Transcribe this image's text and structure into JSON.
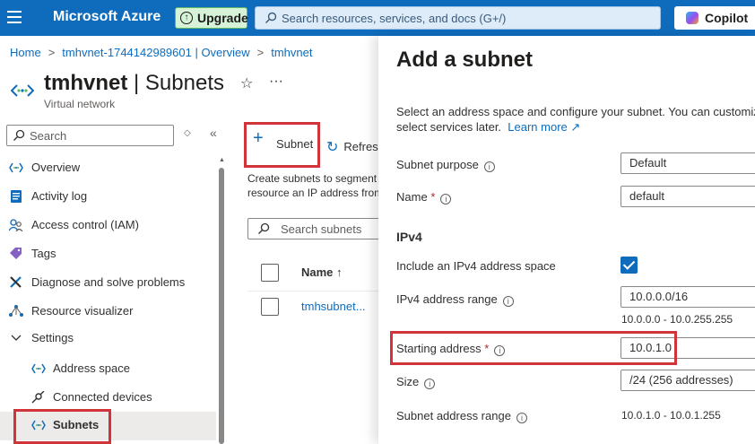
{
  "topbar": {
    "brand": "Microsoft Azure",
    "upgrade_label": "Upgrade",
    "search_placeholder": "Search resources, services, and docs (G+/)",
    "copilot_label": "Copilot"
  },
  "breadcrumb": [
    "Home",
    "tmhvnet-1744142989601 | Overview",
    "tmhvnet"
  ],
  "header": {
    "resource_name": "tmhvnet",
    "page_name": "Subnets",
    "title_separator": " | ",
    "subtitle": "Virtual network"
  },
  "nav": {
    "search_placeholder": "Search",
    "items": [
      {
        "label": "Overview",
        "icon": "vnet-icon"
      },
      {
        "label": "Activity log",
        "icon": "activity-log-icon"
      },
      {
        "label": "Access control (IAM)",
        "icon": "people-icon"
      },
      {
        "label": "Tags",
        "icon": "tag-icon"
      },
      {
        "label": "Diagnose and solve problems",
        "icon": "wrench-icon"
      },
      {
        "label": "Resource visualizer",
        "icon": "network-diagram-icon"
      },
      {
        "label": "Settings",
        "icon": "chevron-down-icon"
      },
      {
        "label": "Address space",
        "icon": "vnet-icon"
      },
      {
        "label": "Connected devices",
        "icon": "plug-icon"
      },
      {
        "label": "Subnets",
        "icon": "vnet-icon"
      }
    ]
  },
  "main": {
    "add_subnet_label": "Subnet",
    "refresh_label": "Refresh",
    "description_line1": "Create subnets to segment",
    "description_line2": "resource an IP address from",
    "search_placeholder": "Search subnets",
    "column_name": "Name ↑",
    "rows": [
      {
        "name": "tmhsubnet..."
      }
    ]
  },
  "panel": {
    "title": "Add a subnet",
    "intro_line1": "Select an address space and configure your subnet. You can customize",
    "intro_line2": "select services later.",
    "learn_more": "Learn more",
    "subnet_purpose_label": "Subnet purpose",
    "subnet_purpose_value": "Default",
    "name_label": "Name",
    "required_mark": "*",
    "name_value": "default",
    "ipv4_heading": "IPv4",
    "include_ipv4_label": "Include an IPv4 address space",
    "include_ipv4_checked": true,
    "ipv4_range_label": "IPv4 address range",
    "ipv4_range_value": "10.0.0.0/16",
    "ipv4_range_span": "10.0.0.0 - 10.0.255.255",
    "starting_address_label": "Starting address",
    "starting_address_value": "10.0.1.0",
    "size_label": "Size",
    "size_value": "/24 (256 addresses)",
    "subnet_range_label": "Subnet address range",
    "subnet_range_value": "10.0.1.0 - 10.0.1.255"
  },
  "colors": {
    "azure_blue": "#0f6cbd",
    "highlight_red": "#d13438"
  }
}
